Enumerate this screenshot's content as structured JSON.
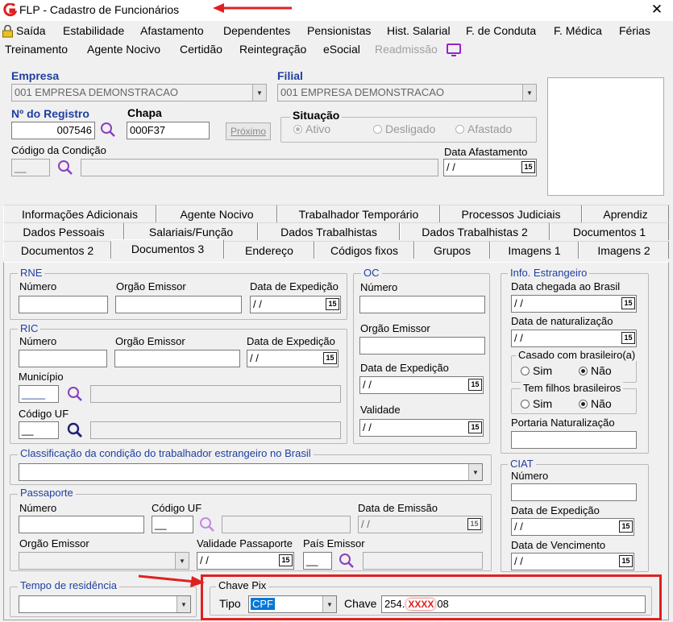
{
  "window": {
    "title": "FLP - Cadastro de Funcionários",
    "close": "✕"
  },
  "menu_row1": [
    "Saída",
    "Estabilidade",
    "Afastamento",
    "Dependentes",
    "Pensionistas",
    "Hist. Salarial",
    "F. de Conduta",
    "F. Médica",
    "Férias"
  ],
  "menu_row2": {
    "items": [
      "Treinamento",
      "Agente Nocivo",
      "Certidão",
      "Reintegração",
      "eSocial"
    ],
    "disabled": "Readmissão"
  },
  "empresa": {
    "label": "Empresa",
    "value": "001 EMPRESA DEMONSTRACAO"
  },
  "filial": {
    "label": "Filial",
    "value": "001 EMPRESA DEMONSTRACAO"
  },
  "registro": {
    "label": "Nº do Registro",
    "value": "007546"
  },
  "chapa": {
    "label": "Chapa",
    "value": "000F37",
    "next_button": "Próximo"
  },
  "situacao": {
    "label": "Situação",
    "options": [
      "Ativo",
      "Desligado",
      "Afastado"
    ],
    "selected": "Ativo"
  },
  "condicao": {
    "label": "Código da Condição",
    "code": "__"
  },
  "data_afastamento": {
    "label": "Data Afastamento",
    "value": " / /"
  },
  "tabs_row1": [
    "Informações Adicionais",
    "Agente Nocivo",
    "Trabalhador Temporário",
    "Processos Judiciais",
    "Aprendiz"
  ],
  "tabs_row2": [
    "Dados Pessoais",
    "Salariais/Função",
    "Dados Trabalhistas",
    "Dados Trabalhistas 2",
    "Documentos 1"
  ],
  "tabs_row3": [
    "Documentos 2",
    "Documentos 3",
    "Endereço",
    "Códigos fixos",
    "Grupos",
    "Imagens 1",
    "Imagens 2"
  ],
  "active_tab": "Documentos 3",
  "rne": {
    "title": "RNE",
    "numero": "Número",
    "orgao": "Orgão Emissor",
    "data": "Data de Expedição",
    "date_value": " / /"
  },
  "ric": {
    "title": "RIC",
    "numero": "Número",
    "orgao": "Orgão Emissor",
    "data": "Data de Expedição",
    "date_value": " / /",
    "municipio": "Município",
    "codigo_uf": "Código UF",
    "codigo_uf_value": "__",
    "municipio_value": "____"
  },
  "oc": {
    "title": "OC",
    "numero": "Número",
    "orgao": "Orgão Emissor",
    "data": "Data de Expedição",
    "validade": "Validade",
    "date_value": " / /"
  },
  "estrangeiro": {
    "title": "Info. Estrangeiro",
    "chegada": "Data chegada ao Brasil",
    "naturalizacao": "Data de naturalização",
    "date_value": " / /",
    "casado": "Casado com brasileiro(a)",
    "filhos": "Tem filhos brasileiros",
    "sim": "Sim",
    "nao": "Não",
    "portaria": "Portaria Naturalização"
  },
  "classificacao": {
    "title": "Classificação da condição do trabalhador estrangeiro no Brasil"
  },
  "passaporte": {
    "title": "Passaporte",
    "numero": "Número",
    "codigo_uf": "Código UF",
    "codigo_uf_value": "__",
    "data_emissao": "Data de Emissão",
    "orgao": "Orgão Emissor",
    "validade": "Validade Passaporte",
    "pais": "País Emissor",
    "date_value": " / /",
    "pais_value": "__"
  },
  "ciat": {
    "title": "CIAT",
    "numero": "Número",
    "expedicao": "Data de Expedição",
    "vencimento": "Data de Vencimento",
    "date_value": " / /"
  },
  "residencia": {
    "title": "Tempo de residência"
  },
  "chave_pix": {
    "title": "Chave Pix",
    "tipo_label": "Tipo",
    "tipo_value": "CPF",
    "chave_label": "Chave",
    "chave_prefix": "254.",
    "chave_masked": "XXXX",
    "chave_suffix": "08"
  },
  "colors": {
    "accent_red": "#e02020",
    "label_blue": "#1f3fa0",
    "selection_blue": "#0078d7",
    "menu_magenta": "#9b1fd0"
  },
  "icons": {
    "app": "flp-logo-icon",
    "search": "magnifier-icon",
    "calendar": "calendar-15-icon",
    "exit": "padlock-icon",
    "monitor": "monitor-icon"
  },
  "calendar_text": "15"
}
